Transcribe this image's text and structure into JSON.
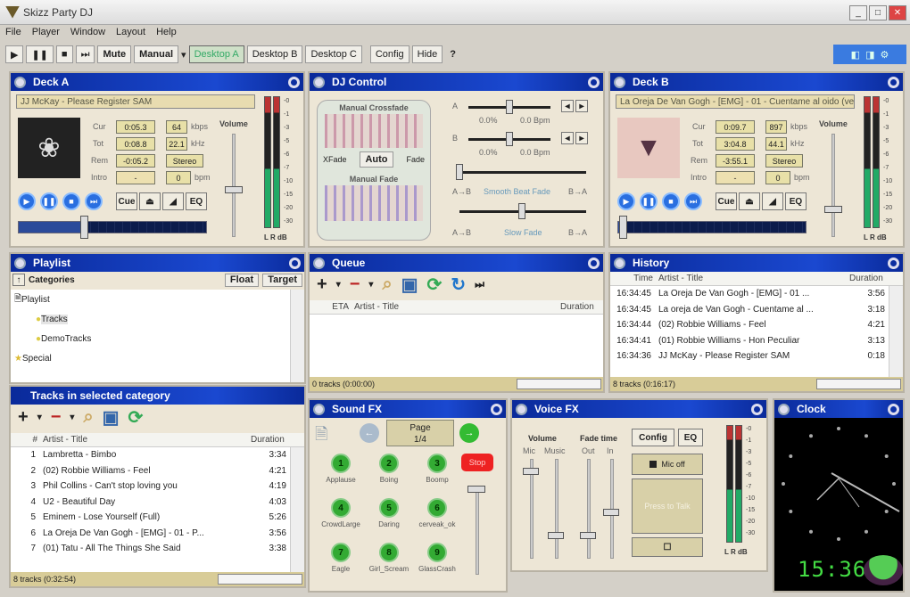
{
  "window": {
    "title": "Skizz Party DJ",
    "controls": [
      "_",
      "□",
      "✕"
    ]
  },
  "menu": [
    "File",
    "Player",
    "Window",
    "Layout",
    "Help"
  ],
  "toolbar": {
    "play": "▶",
    "pause": "❚❚",
    "stop": "■",
    "next": "⏭",
    "mute": "Mute",
    "mode": "Manual",
    "mode_arrow": "▾",
    "desktops": [
      "Desktop A",
      "Desktop B",
      "Desktop C"
    ],
    "config": "Config",
    "hide": "Hide",
    "help": "?"
  },
  "decks": [
    {
      "title": "Deck A",
      "track": "JJ McKay - Please Register SAM",
      "cur": "0:05.3",
      "tot": "0:08.8",
      "rem": "-0:05.2",
      "intro": "-",
      "kbps": "64",
      "khz": "22.1",
      "channels": "Stereo",
      "bpm": "0",
      "volume_label": "Volume",
      "position_fraction": 0.35,
      "volume_fraction": 0.45
    },
    {
      "title": "Deck B",
      "track": "La Oreja De Van Gogh - [EMG] - 01 - Cuentame al oido (version original)",
      "cur": "0:09.7",
      "tot": "3:04.8",
      "rem": "-3:55.1",
      "intro": "-",
      "kbps": "897",
      "khz": "44.1",
      "channels": "Stereo",
      "bpm": "0",
      "volume_label": "Volume",
      "position_fraction": 0.03,
      "volume_fraction": 0.25
    }
  ],
  "deck_labels": {
    "cur": "Cur",
    "tot": "Tot",
    "rem": "Rem",
    "intro": "Intro",
    "kbps": "kbps",
    "khz": "kHz",
    "bpm": "bpm",
    "cue": "Cue",
    "eq": "EQ",
    "meter_footer": "L R dB"
  },
  "meter_scale": [
    "-0",
    "-1",
    "-3",
    "-5",
    "-6",
    "-7",
    "-10",
    "-15",
    "-20",
    "-30"
  ],
  "dj": {
    "title": "DJ Control",
    "manual_crossfade": "Manual Crossfade",
    "xfade": "XFade",
    "auto": "Auto",
    "fade": "Fade",
    "manual_fade": "Manual Fade",
    "a": "A",
    "b": "B",
    "pitch_a": "0.0%",
    "bpm_a": "0.0 Bpm",
    "pitch_b": "0.0%",
    "bpm_b": "0.0 Bpm",
    "smooth": "Smooth Beat Fade",
    "slow": "Slow Fade",
    "a_to_b": "A→B",
    "b_to_a": "B→A"
  },
  "playlist": {
    "title": "Playlist",
    "categories": "Categories",
    "float": "Float",
    "target": "Target",
    "tree": [
      "Playlist",
      "Tracks",
      "DemoTracks",
      "Special"
    ]
  },
  "tracks": {
    "title": "Tracks in selected category",
    "cols": [
      "#",
      "Artist - Title",
      "Duration"
    ],
    "rows": [
      [
        "1",
        "Lambretta - Bimbo",
        "3:34"
      ],
      [
        "2",
        "(02) Robbie Williams - Feel",
        "4:21"
      ],
      [
        "3",
        "Phil Collins - Can't stop loving you",
        "4:19"
      ],
      [
        "4",
        "U2 - Beautiful Day",
        "4:03"
      ],
      [
        "5",
        "Eminem - Lose Yourself (Full)",
        "5:26"
      ],
      [
        "6",
        "La Oreja De Van Gogh - [EMG] - 01 - P...",
        "3:56"
      ],
      [
        "7",
        "(01) Tatu - All The Things She Said",
        "3:38"
      ]
    ],
    "status": "8 tracks (0:32:54)"
  },
  "queue": {
    "title": "Queue",
    "cols": [
      "ETA",
      "Artist - Title",
      "Duration"
    ],
    "status": "0 tracks (0:00:00)"
  },
  "history": {
    "title": "History",
    "cols": [
      "Time",
      "Artist - Title",
      "Duration"
    ],
    "rows": [
      [
        "16:34:45",
        "La Oreja De Van Gogh - [EMG] - 01 ...",
        "3:56"
      ],
      [
        "16:34:45",
        "La oreja de Van Gogh - Cuentame al ...",
        "3:18"
      ],
      [
        "16:34:44",
        "(02) Robbie Williams - Feel",
        "4:21"
      ],
      [
        "16:34:41",
        "(01) Robbie Williams - Hon Peculiar",
        "3:13"
      ],
      [
        "16:34:36",
        "JJ McKay - Please Register SAM",
        "0:18"
      ]
    ],
    "status": "8 tracks (0:16:17)"
  },
  "soundfx": {
    "title": "Sound FX",
    "page": "Page",
    "page_num": "1/4",
    "stop": "Stop",
    "pads": [
      [
        "1",
        "Applause"
      ],
      [
        "2",
        "Boing"
      ],
      [
        "3",
        "Boomp"
      ],
      [
        "4",
        "CrowdLarge"
      ],
      [
        "5",
        "Daring"
      ],
      [
        "6",
        "cerveak_ok"
      ],
      [
        "7",
        "Eagle"
      ],
      [
        "8",
        "Girl_Scream"
      ],
      [
        "9",
        "GlassCrash"
      ]
    ]
  },
  "voicefx": {
    "title": "Voice FX",
    "volume": "Volume",
    "fade_time": "Fade time",
    "mic": "Mic",
    "music": "Music",
    "out": "Out",
    "in": "In",
    "config": "Config",
    "eq": "EQ",
    "mic_off": "Mic off",
    "press_to_talk": "Press to Talk"
  },
  "clock": {
    "title": "Clock",
    "time": "15:36"
  }
}
